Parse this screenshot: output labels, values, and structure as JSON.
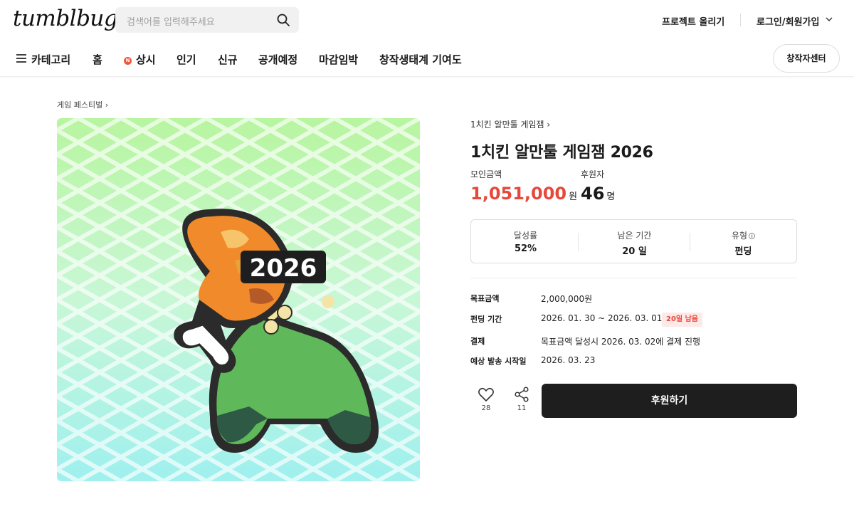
{
  "header": {
    "logo": "tumblbug",
    "search_placeholder": "검색어를 입력해주세요",
    "create_project": "프로젝트 올리기",
    "login": "로그인/회원가입"
  },
  "nav": {
    "category": "카테고리",
    "items": [
      "홈",
      "상시",
      "인기",
      "신규",
      "공개예정",
      "마감임박",
      "창작생태계 기여도"
    ],
    "new_badge": "N",
    "creator_center": "창작자센터"
  },
  "breadcrumb": "게임 페스티벌",
  "hero": {
    "badge_text": "2026"
  },
  "project": {
    "jam_link": "1치킨 알만툴 게임잼",
    "title": "1치킨 알만툴 게임잼 2026",
    "amount_label": "모인금액",
    "amount": "1,051,000",
    "amount_unit": "원",
    "backers_label": "후원자",
    "backers": "46",
    "backers_unit": "명"
  },
  "stats": [
    {
      "label": "달성률",
      "value": "52%"
    },
    {
      "label": "남은 기간",
      "value": "20 일"
    },
    {
      "label": "유형",
      "value": "펀딩",
      "info_icon": "i"
    }
  ],
  "details": {
    "goal_label": "목표금액",
    "goal": "2,000,000원",
    "period_label": "펀딩 기간",
    "period": "2026. 01. 30 ~ 2026. 03. 01",
    "remaining_badge": "20일 남음",
    "payment_label": "결제",
    "payment": "목표금액 달성시 2026. 03. 02에 결제 진행",
    "delivery_label": "예상 발송 시작일",
    "delivery": "2026. 03. 23"
  },
  "actions": {
    "likes": "28",
    "shares": "11",
    "back_button": "후원하기"
  },
  "colors": {
    "accent_red": "#e6493b",
    "button_dark": "#1e1e1e"
  }
}
